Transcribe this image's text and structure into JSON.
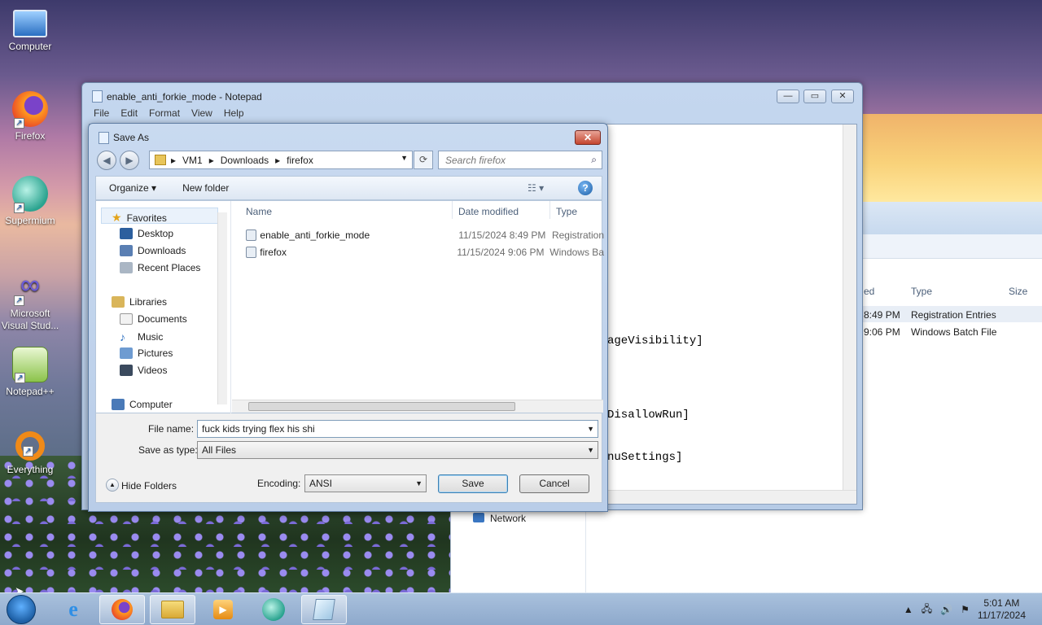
{
  "desktop_icons": [
    {
      "label": "Computer"
    },
    {
      "label": "Firefox"
    },
    {
      "label": "Supermium"
    },
    {
      "label": "Microsoft Visual Stud..."
    },
    {
      "label": "Notepad++"
    },
    {
      "label": "Everything"
    }
  ],
  "explorer_bg": {
    "col_modified": "ed",
    "col_type": "Type",
    "col_size": "Size",
    "rows": [
      {
        "modified": "8:49 PM",
        "type": "Registration Entries"
      },
      {
        "modified": "9:06 PM",
        "type": "Windows Batch File"
      }
    ],
    "network_label": "Network"
  },
  "notepad": {
    "title": "enable_anti_forkie_mode - Notepad",
    "menu": [
      "File",
      "Edit",
      "Format",
      "View",
      "Help"
    ],
    "visible_lines": [
      "ageVisibility]",
      "DisallowRun]",
      "nuSettings]"
    ]
  },
  "save_dialog": {
    "title": "Save As",
    "breadcrumb": [
      "VM1",
      "Downloads",
      "firefox"
    ],
    "search_placeholder": "Search firefox",
    "toolbar": {
      "organize": "Organize ▾",
      "new_folder": "New folder"
    },
    "nav": {
      "favorites": "Favorites",
      "favorites_items": [
        "Desktop",
        "Downloads",
        "Recent Places"
      ],
      "libraries": "Libraries",
      "libraries_items": [
        "Documents",
        "Music",
        "Pictures",
        "Videos"
      ],
      "computer": "Computer"
    },
    "columns": {
      "name": "Name",
      "date": "Date modified",
      "type": "Type"
    },
    "files": [
      {
        "name": "enable_anti_forkie_mode",
        "date": "11/15/2024 8:49 PM",
        "type": "Registration"
      },
      {
        "name": "firefox",
        "date": "11/15/2024 9:06 PM",
        "type": "Windows Ba"
      }
    ],
    "file_name_label": "File name:",
    "file_name_value": "fuck kids trying flex his shi",
    "save_type_label": "Save as type:",
    "save_type_value": "All Files",
    "hide_folders": "Hide Folders",
    "encoding_label": "Encoding:",
    "encoding_value": "ANSI",
    "save_button": "Save",
    "cancel_button": "Cancel"
  },
  "taskbar": {
    "time": "5:01 AM",
    "date": "11/17/2024"
  }
}
